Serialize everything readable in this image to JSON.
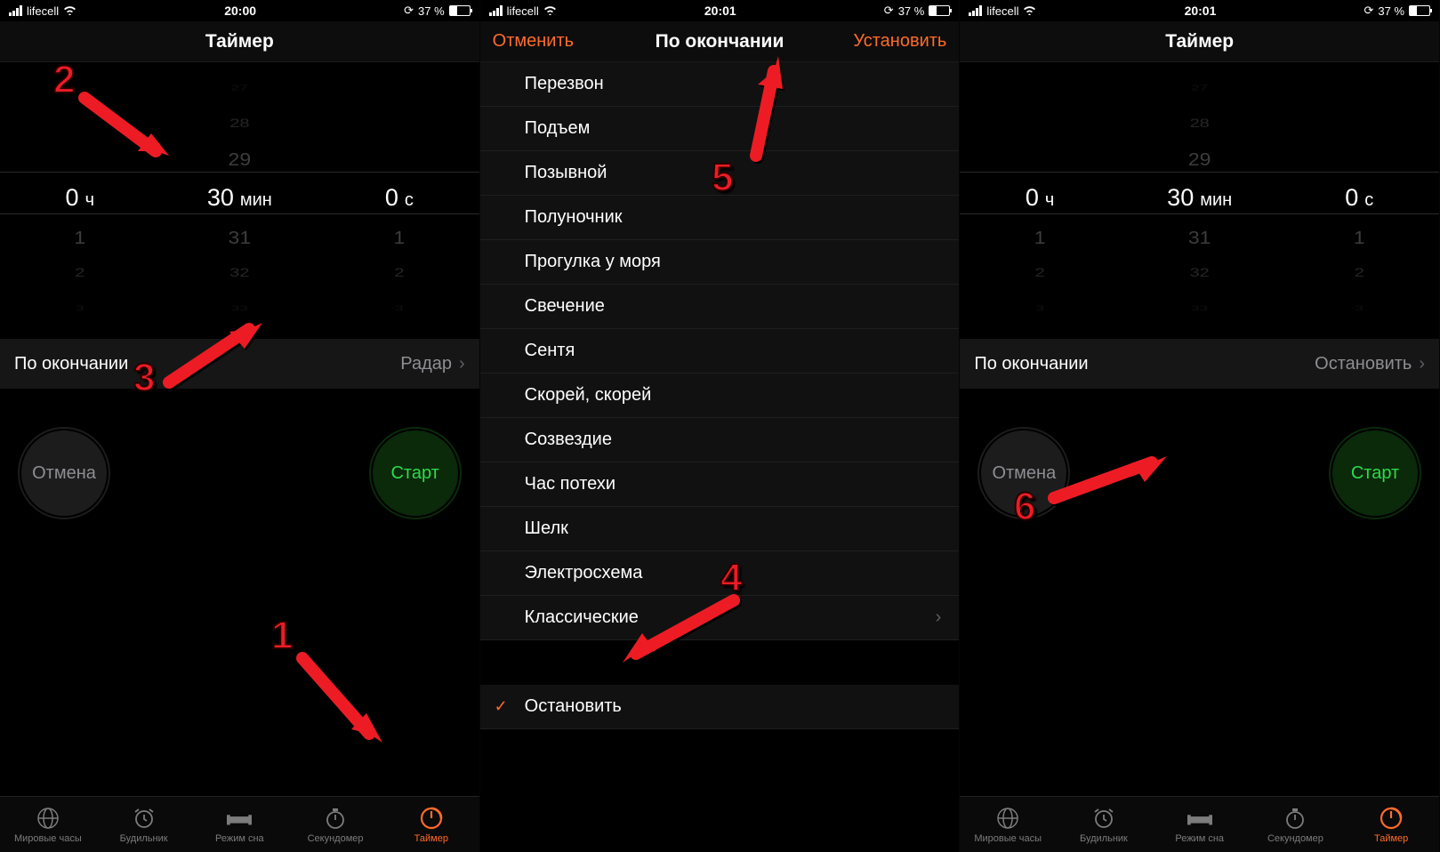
{
  "status": {
    "carrier": "lifecell",
    "battery": "37 %"
  },
  "screens": [
    {
      "time": "20:00",
      "type": "timer",
      "end_value": "Радар"
    },
    {
      "time": "20:01",
      "type": "sounds"
    },
    {
      "time": "20:01",
      "type": "timer",
      "end_value": "Остановить"
    }
  ],
  "timer": {
    "title": "Таймер",
    "h_val": "0",
    "h_unit": "ч",
    "m_above": [
      "27",
      "28",
      "29"
    ],
    "m_val": "30",
    "m_unit": "мин",
    "m_below": [
      "31",
      "32",
      "33"
    ],
    "s_val": "0",
    "s_unit": "с",
    "side_above": [],
    "side_below": [
      "1",
      "2",
      "3"
    ],
    "end_label": "По окончании",
    "cancel": "Отмена",
    "start": "Старт"
  },
  "sounds": {
    "cancel": "Отменить",
    "title": "По окончании",
    "set": "Установить",
    "items": [
      "Перезвон",
      "Подъем",
      "Позывной",
      "Полуночник",
      "Прогулка у моря",
      "Свечение",
      "Сентя",
      "Скорей, скорей",
      "Созвездие",
      "Час потехи",
      "Шелк",
      "Электросхема"
    ],
    "classic": "Классические",
    "stop": "Остановить"
  },
  "tabs": {
    "world": "Мировые часы",
    "alarm": "Будильник",
    "sleep": "Режим сна",
    "stopwatch": "Секундомер",
    "timer": "Таймер"
  },
  "steps": {
    "s1": "1",
    "s2": "2",
    "s3": "3",
    "s4": "4",
    "s5": "5",
    "s6": "6"
  }
}
